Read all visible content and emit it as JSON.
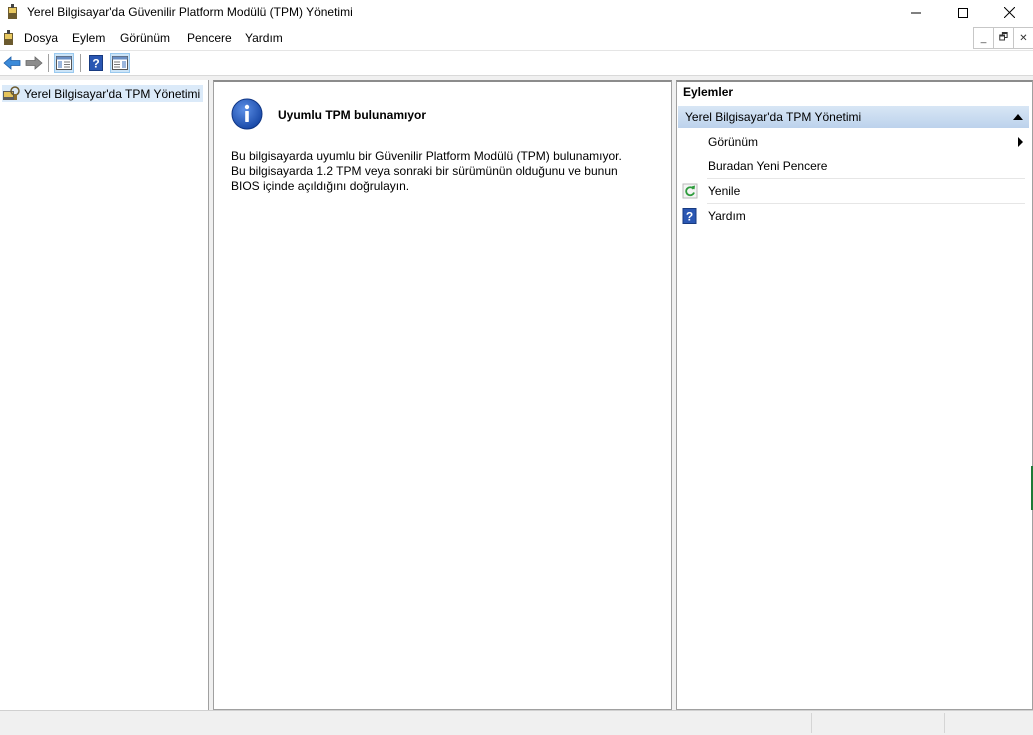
{
  "window": {
    "title": "Yerel Bilgisayar'da Güvenilir Platform Modülü (TPM) Yönetimi",
    "min_glyph": "—",
    "max_glyph": "☐",
    "close_glyph": "✕"
  },
  "menu": {
    "items": [
      "Dosya",
      "Eylem",
      "Görünüm",
      "Pencere",
      "Yardım"
    ]
  },
  "mdi": {
    "min": "_",
    "restore": "🗗",
    "close": "✕"
  },
  "toolbar": {
    "buttons": [
      "back-icon",
      "forward-icon",
      "show-hide-console-tree-icon",
      "help-icon",
      "show-hide-action-pane-icon"
    ]
  },
  "tree": {
    "root_label": "Yerel Bilgisayar'da TPM Yönetimi"
  },
  "main": {
    "heading": "Uyumlu TPM bulunamıyor",
    "body_lines": [
      "Bu bilgisayarda uyumlu bir Güvenilir Platform Modülü (TPM) bulunamıyor.",
      "Bu bilgisayarda 1.2 TPM veya sonraki bir sürümünün olduğunu ve bunun",
      "BIOS içinde açıldığını doğrulayın."
    ]
  },
  "actions": {
    "header": "Eylemler",
    "group_label": "Yerel Bilgisayar'da TPM Yönetimi",
    "items": [
      {
        "label": "Görünüm",
        "icon": "",
        "submenu": true
      },
      {
        "label": "Buradan Yeni Pencere",
        "icon": "",
        "submenu": false
      },
      {
        "label": "Yenile",
        "icon": "refresh-icon",
        "submenu": false
      },
      {
        "label": "Yardım",
        "icon": "help-icon",
        "submenu": false
      }
    ]
  },
  "colors": {
    "selection": "#dbeaf9",
    "group_header": "#bcd2ec",
    "info_blue": "#1d5bbf"
  }
}
